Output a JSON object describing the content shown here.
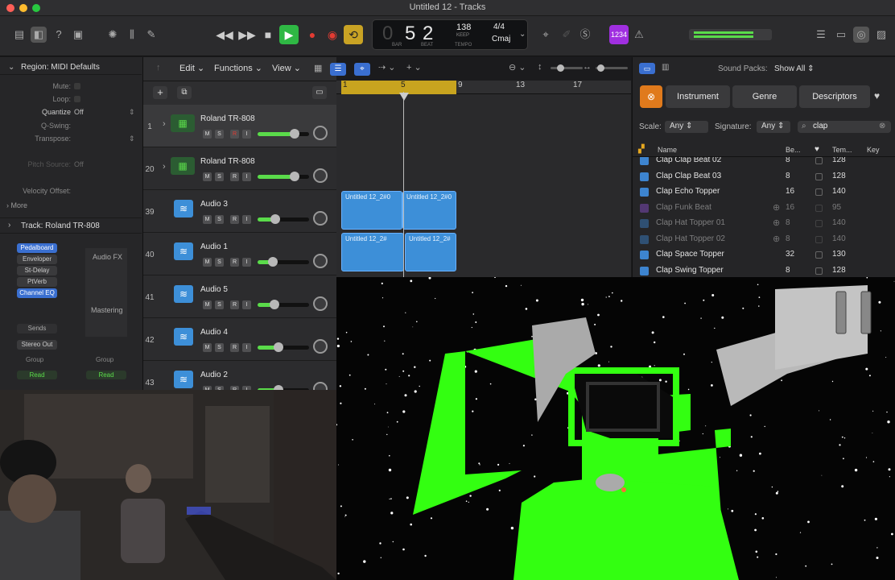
{
  "window": {
    "title": "Untitled 12 - Tracks"
  },
  "lcd": {
    "bar": "5",
    "beat": "2",
    "bar_label": "BAR",
    "beat_label": "BEAT",
    "tempo": "138",
    "keep": "KEEP",
    "tempo_label": "TEMPO",
    "signature": "4/4",
    "key": "Cmaj"
  },
  "count_in_badge": "1234",
  "inspector": {
    "region_header": "Region: MIDI Defaults",
    "rows": [
      {
        "k": "Mute:",
        "v": ""
      },
      {
        "k": "Loop:",
        "v": ""
      },
      {
        "k": "Quantize",
        "v": "Off"
      },
      {
        "k": "Q-Swing:",
        "v": ""
      },
      {
        "k": "Transpose:",
        "v": ""
      },
      {
        "k": "Pitch Source:",
        "v": "Off"
      },
      {
        "k": "Velocity Offset:",
        "v": ""
      }
    ],
    "more": "More",
    "track_header": "Track: Roland TR-808",
    "plugins": [
      "Pedalboard",
      "Enveloper",
      "St-Delay",
      "PtVerb",
      "Channel EQ"
    ],
    "audio_fx": "Audio FX",
    "mastering": "Mastering",
    "sends": "Sends",
    "stereo_out": "Stereo Out",
    "group1": "Group",
    "group2": "Group",
    "read1": "Read",
    "read2": "Read"
  },
  "tracks_header": {
    "edit": "Edit",
    "functions": "Functions",
    "view": "View"
  },
  "tracks": [
    {
      "num": "1",
      "name": "Roland TR-808",
      "type": "drum",
      "vol": 0.72
    },
    {
      "num": "20",
      "name": "Roland TR-808",
      "type": "drum",
      "vol": 0.72
    },
    {
      "num": "39",
      "name": "Audio 3",
      "type": "audio",
      "vol": 0.35
    },
    {
      "num": "40",
      "name": "Audio 1",
      "type": "audio",
      "vol": 0.3
    },
    {
      "num": "41",
      "name": "Audio 5",
      "type": "audio",
      "vol": 0.33
    },
    {
      "num": "42",
      "name": "Audio 4",
      "type": "audio",
      "vol": 0.4
    },
    {
      "num": "43",
      "name": "Audio 2",
      "type": "audio",
      "vol": 0.4
    }
  ],
  "ruler": [
    "1",
    "5",
    "9",
    "13",
    "17"
  ],
  "regions": {
    "r1": "Untitled 12_2#0",
    "r2": "Untitled 12_2#0",
    "r3": "Untitled 12_2#",
    "r4": "Untitled 12_2#"
  },
  "browser": {
    "sound_packs_label": "Sound Packs:",
    "sound_packs_value": "Show All",
    "tab_instrument": "Instrument",
    "tab_genre": "Genre",
    "tab_descriptors": "Descriptors",
    "scale_label": "Scale:",
    "scale_value": "Any",
    "signature_label": "Signature:",
    "signature_value": "Any",
    "search_value": "clap",
    "columns": {
      "name": "Name",
      "beats": "Be...",
      "tempo": "Tem...",
      "key": "Key"
    },
    "rows": [
      {
        "name": "Clap Clap Beat 02",
        "beats": "8",
        "tempo": "128",
        "dim": false
      },
      {
        "name": "Clap Clap Beat 03",
        "beats": "8",
        "tempo": "128",
        "dim": false
      },
      {
        "name": "Clap Echo Topper",
        "beats": "16",
        "tempo": "140",
        "dim": false
      },
      {
        "name": "Clap Funk Beat",
        "beats": "16",
        "tempo": "95",
        "dim": true
      },
      {
        "name": "Clap Hat Topper 01",
        "beats": "8",
        "tempo": "140",
        "dim": true
      },
      {
        "name": "Clap Hat Topper 02",
        "beats": "8",
        "tempo": "140",
        "dim": true
      },
      {
        "name": "Clap Space Topper",
        "beats": "32",
        "tempo": "130",
        "dim": false
      },
      {
        "name": "Clap Swing Topper",
        "beats": "8",
        "tempo": "128",
        "dim": false
      }
    ]
  },
  "colors": {
    "accent": "#5adb4a",
    "region_blue": "#3d8fd8",
    "game_green": "#33ff11",
    "play_green": "#2fb844",
    "record_red": "#e33b32"
  }
}
